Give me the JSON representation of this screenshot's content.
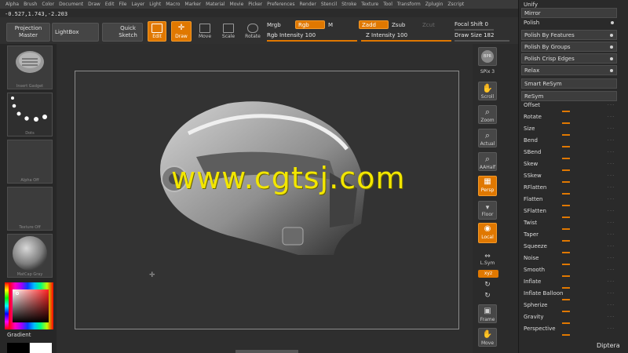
{
  "menu": [
    "Alpha",
    "Brush",
    "Color",
    "Document",
    "Draw",
    "Edit",
    "File",
    "Layer",
    "Light",
    "Macro",
    "Marker",
    "Material",
    "Movie",
    "Picker",
    "Preferences",
    "Render",
    "Stencil",
    "Stroke",
    "Texture",
    "Tool",
    "Transform",
    "Zplugin",
    "Zscript"
  ],
  "coords": "-0.527,1.743,-2.203",
  "shelf": {
    "projection_master": "Projection Master",
    "lightbox": "LightBox",
    "quick_sketch": "Quick Sketch",
    "edit": "Edit",
    "draw": "Draw",
    "move": "Move",
    "scale": "Scale",
    "rotate": "Rotate",
    "mrgb": "Mrgb",
    "rgb": "Rgb",
    "m": "M",
    "zadd": "Zadd",
    "zsub": "Zsub",
    "zcut": "Zcut",
    "rgb_intensity": "Rgb Intensity 100",
    "z_intensity": "Z Intensity 100",
    "focal_shift": "Focal Shift 0",
    "draw_size": "Draw Size 182"
  },
  "left": {
    "insert": "Insert Gadget",
    "dots": "Dots",
    "alpha": "Alpha Off",
    "texture": "Texture Off",
    "matcap": "MatCap Gray",
    "gradient": "Gradient"
  },
  "right_tools": {
    "bpr": "BPR",
    "spix": "SPix 3",
    "scroll": "Scroll",
    "zoom": "Zoom",
    "actual": "Actual",
    "aahalf": "AAHalf",
    "persp": "Persp",
    "floor": "Floor",
    "local": "Local",
    "lsym": "L.Sym",
    "xyz": "xyz",
    "frame": "Frame",
    "move": "Move"
  },
  "palette": {
    "unify": "Unify",
    "mirror": "Mirror",
    "polish": "Polish",
    "polish_features": "Polish By Features",
    "polish_groups": "Polish By Groups",
    "polish_crisp": "Polish Crisp Edges",
    "relax": "Relax",
    "smart_resym": "Smart ReSym",
    "resym": "ReSym",
    "deformations": [
      "Offset",
      "Rotate",
      "Size",
      "Bend",
      "SBend",
      "Skew",
      "SSkew",
      "RFlatten",
      "Flatten",
      "SFlatten",
      "Twist",
      "Taper",
      "Squeeze",
      "Noise",
      "Smooth",
      "Inflate",
      "Inflate Balloon",
      "Spherize",
      "Gravity",
      "Perspective"
    ]
  },
  "watermark": "www.cgtsj.com",
  "diptera": "Diptera",
  "colors": {
    "accent": "#e07800",
    "panel": "#2a2a2a",
    "watermark": "#f2e600"
  }
}
